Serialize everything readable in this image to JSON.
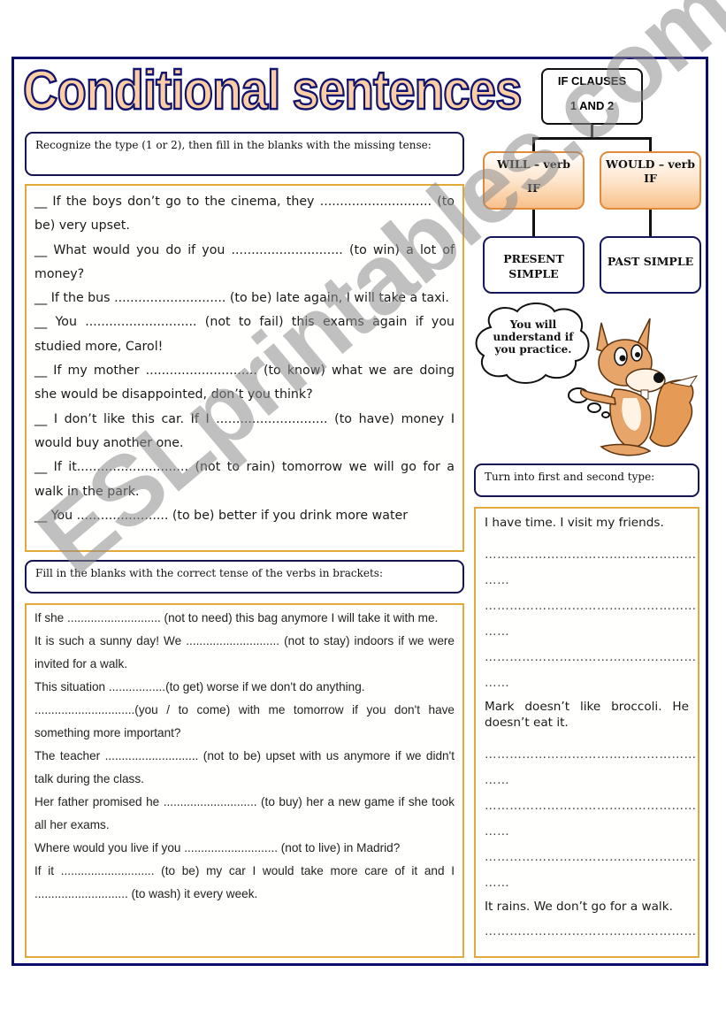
{
  "title": "Conditional sentences",
  "diagram": {
    "root_line1": "IF CLAUSES",
    "root_line2": "1 AND 2",
    "type1_line1": "WILL – verb",
    "type1_line2": "IF",
    "type2_line1": "WOULD – verb",
    "type2_line2": "IF",
    "type1_tense": "PRESENT SIMPLE",
    "type2_tense": "PAST SIMPLE"
  },
  "speech_bubble": "You will understand if you practice.",
  "exercise1": {
    "instruction": "Recognize the type (1 or 2), then fill in the blanks with the missing tense:",
    "items": [
      "__ If the boys don’t go to the cinema, they ............................ (to be) very upset.",
      "__ What would you do if you ............................ (to win) a lot of money?",
      "__ If the bus ............................ (to be) late again, I will take a taxi.",
      "__ You ............................ (not to fail) this exams again if you studied more, Carol!",
      "__ If my mother ............................ (to know) what we are doing she would be disappointed, don’t you think?",
      "__ I don’t like this car. If I ............................ (to have) money I would buy another one.",
      "__ If it............................ (not to rain) tomorrow we will go for a walk in the park.",
      "__ You ....................... (to be) better if you drink more water"
    ]
  },
  "exercise2": {
    "instruction": "Fill in the blanks with the correct tense of the verbs in brackets:",
    "items": [
      "If she ............................ (not to need) this bag anymore I will take it with me.",
      "It is such a sunny day! We ............................ (not to stay) indoors if we were invited for a walk.",
      "This situation .................(to get) worse if we don't do anything.",
      "..............................(you / to come) with me tomorrow if you don't have something more important?",
      "The teacher ............................ (not to be) upset with us anymore if we didn't talk during the class.",
      "Her father promised he ............................ (to buy) her a new game if she took all her exams.",
      "Where would you live if you ............................ (not to live) in Madrid?",
      "If it ............................ (to be) my car I would take more care of it and I ............................ (to wash) it every week."
    ]
  },
  "exercise3": {
    "instruction": "Turn into first and second type:",
    "answer_line": "……………………………………………",
    "answer_tail": "……",
    "items": [
      "I have time. I visit my friends.",
      "Mark doesn’t like broccoli. He doesn’t eat it.",
      "It rains. We don’t go for a walk."
    ]
  },
  "watermark": "ESLprintables.com",
  "colors": {
    "frame": "#0c0c6a",
    "title_fill": "#fbcfa3",
    "panel_border": "#e3a93a",
    "orange_box_border": "#e08b3c"
  }
}
